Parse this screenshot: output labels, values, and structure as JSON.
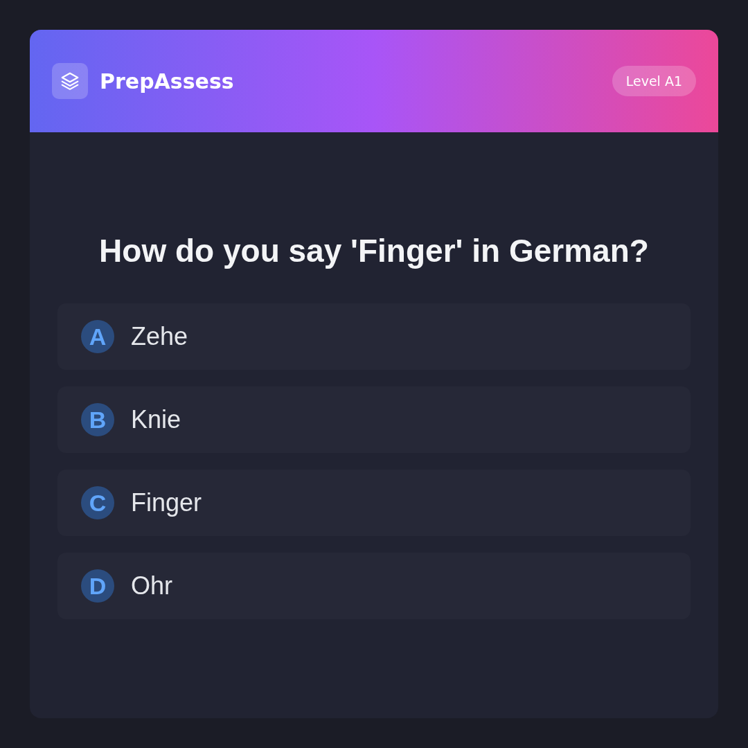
{
  "header": {
    "app_name": "PrepAssess",
    "badge": "Level A1"
  },
  "question": "How do you say 'Finger' in German?",
  "options": [
    {
      "letter": "A",
      "text": "Zehe",
      "selected": false
    },
    {
      "letter": "B",
      "text": "Knie",
      "selected": false
    },
    {
      "letter": "C",
      "text": "Finger",
      "selected": false
    },
    {
      "letter": "D",
      "text": "Ohr",
      "selected": false
    }
  ]
}
